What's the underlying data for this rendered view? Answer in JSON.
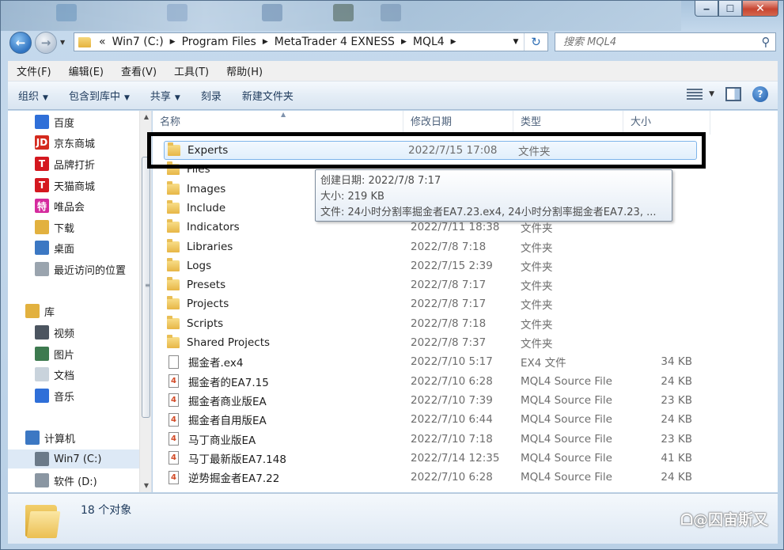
{
  "address": {
    "crumbs": [
      "Win7 (C:)",
      "Program Files",
      "MetaTrader 4 EXNESS",
      "MQL4"
    ],
    "overflow": "«"
  },
  "search": {
    "placeholder": "搜索 MQL4"
  },
  "menu": [
    "文件(F)",
    "编辑(E)",
    "查看(V)",
    "工具(T)",
    "帮助(H)"
  ],
  "commands": [
    {
      "label": "组织",
      "dropdown": true
    },
    {
      "label": "包含到库中",
      "dropdown": true
    },
    {
      "label": "共享",
      "dropdown": true
    },
    {
      "label": "刻录",
      "dropdown": false
    },
    {
      "label": "新建文件夹",
      "dropdown": false
    }
  ],
  "nav": [
    {
      "label": "百度",
      "icon": "baidu-icon",
      "color": "#2f6fd8"
    },
    {
      "label": "京东商城",
      "icon": "jd-icon",
      "color": "#d42a1e",
      "glyph": "JD"
    },
    {
      "label": "品牌打折",
      "icon": "tmall-icon",
      "color": "#d4181f",
      "glyph": "T"
    },
    {
      "label": "天猫商城",
      "icon": "tmall-icon",
      "color": "#d4181f",
      "glyph": "T"
    },
    {
      "label": "唯品会",
      "icon": "vip-icon",
      "color": "#d52b9e",
      "glyph": "特"
    },
    {
      "label": "下载",
      "icon": "download-folder-icon",
      "color": "#e2b13f"
    },
    {
      "label": "桌面",
      "icon": "desktop-icon",
      "color": "#3c78c3"
    },
    {
      "label": "最近访问的位置",
      "icon": "recent-places-icon",
      "color": "#9aa4ae"
    },
    {
      "label": "库",
      "icon": "library-icon",
      "color": "#e2b13f"
    },
    {
      "label": "视频",
      "icon": "video-icon",
      "color": "#4c5560"
    },
    {
      "label": "图片",
      "icon": "pictures-icon",
      "color": "#3d7a4f"
    },
    {
      "label": "文档",
      "icon": "documents-icon",
      "color": "#c9d3dc"
    },
    {
      "label": "音乐",
      "icon": "music-icon",
      "color": "#2f6fd8"
    },
    {
      "label": "计算机",
      "icon": "computer-icon",
      "color": "#3c78c3"
    },
    {
      "label": "Win7 (C:)",
      "icon": "drive-icon",
      "color": "#6b7a89"
    },
    {
      "label": "软件 (D:)",
      "icon": "drive-icon",
      "color": "#8a96a2"
    }
  ],
  "columns": {
    "name": "名称",
    "date": "修改日期",
    "type": "类型",
    "size": "大小"
  },
  "files": [
    {
      "name": "Experts",
      "date": "2022/7/15 17:08",
      "type": "文件夹",
      "size": "",
      "kind": "folder"
    },
    {
      "name": "Files",
      "date": "",
      "type": "",
      "size": "",
      "kind": "folder"
    },
    {
      "name": "Images",
      "date": "",
      "type": "",
      "size": "",
      "kind": "folder"
    },
    {
      "name": "Include",
      "date": "",
      "type": "",
      "size": "",
      "kind": "folder"
    },
    {
      "name": "Indicators",
      "date": "2022/7/11 18:38",
      "type": "文件夹",
      "size": "",
      "kind": "folder"
    },
    {
      "name": "Libraries",
      "date": "2022/7/8 7:18",
      "type": "文件夹",
      "size": "",
      "kind": "folder"
    },
    {
      "name": "Logs",
      "date": "2022/7/15 2:39",
      "type": "文件夹",
      "size": "",
      "kind": "folder"
    },
    {
      "name": "Presets",
      "date": "2022/7/8 7:17",
      "type": "文件夹",
      "size": "",
      "kind": "folder"
    },
    {
      "name": "Projects",
      "date": "2022/7/8 7:17",
      "type": "文件夹",
      "size": "",
      "kind": "folder"
    },
    {
      "name": "Scripts",
      "date": "2022/7/8 7:18",
      "type": "文件夹",
      "size": "",
      "kind": "folder"
    },
    {
      "name": "Shared Projects",
      "date": "2022/7/8 7:37",
      "type": "文件夹",
      "size": "",
      "kind": "folder"
    },
    {
      "name": "掘金者.ex4",
      "date": "2022/7/10 5:17",
      "type": "EX4 文件",
      "size": "34 KB",
      "kind": "file"
    },
    {
      "name": "掘金者的EA7.15",
      "date": "2022/7/10 6:28",
      "type": "MQL4 Source File",
      "size": "24 KB",
      "kind": "mq4"
    },
    {
      "name": "掘金者商业版EA",
      "date": "2022/7/10 7:39",
      "type": "MQL4 Source File",
      "size": "23 KB",
      "kind": "mq4"
    },
    {
      "name": "掘金者自用版EA",
      "date": "2022/7/10 6:44",
      "type": "MQL4 Source File",
      "size": "24 KB",
      "kind": "mq4"
    },
    {
      "name": "马丁商业版EA",
      "date": "2022/7/10 7:18",
      "type": "MQL4 Source File",
      "size": "23 KB",
      "kind": "mq4"
    },
    {
      "name": "马丁最新版EA7.148",
      "date": "2022/7/14 12:35",
      "type": "MQL4 Source File",
      "size": "41 KB",
      "kind": "mq4"
    },
    {
      "name": "逆势掘金者EA7.22",
      "date": "2022/7/10 6:28",
      "type": "MQL4 Source File",
      "size": "24 KB",
      "kind": "mq4"
    }
  ],
  "tooltip": {
    "created": "创建日期: 2022/7/8 7:17",
    "size": "大小: 219 KB",
    "files": "文件: 24小时分割率掘金者EA7.23.ex4, 24小时分割率掘金者EA7.23, ..."
  },
  "status": {
    "count": "18 个对象"
  },
  "watermark": "ᗝ@囚宙斯又",
  "colors": {
    "accent": "#3c78c3",
    "highlight_border": "#000000",
    "hover": "#e1effc"
  }
}
